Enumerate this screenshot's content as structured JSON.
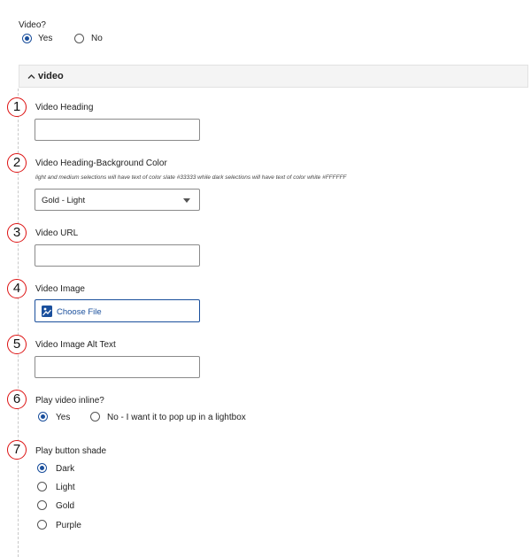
{
  "video_toggle": {
    "label": "Video?",
    "options": [
      "Yes",
      "No"
    ],
    "selected": "Yes"
  },
  "section": {
    "chevron": "chevron-up-icon",
    "title": "video"
  },
  "fields": {
    "heading": {
      "number": "1",
      "label": "Video Heading",
      "value": ""
    },
    "bg_color": {
      "number": "2",
      "label": "Video Heading-Background Color",
      "help": "light and medium selections will have text of color slate #33333 while dark selections will have text of color white #FFFFFF",
      "value": "Gold - Light"
    },
    "url": {
      "number": "3",
      "label": "Video URL",
      "value": ""
    },
    "image": {
      "number": "4",
      "label": "Video Image",
      "button": "Choose File",
      "icon": "image-file-icon"
    },
    "alt_text": {
      "number": "5",
      "label": "Video Image Alt Text",
      "value": ""
    },
    "inline": {
      "number": "6",
      "label": "Play video inline?",
      "options": [
        "Yes",
        "No - I want it to pop up in a lightbox"
      ],
      "selected": "Yes"
    },
    "shade": {
      "number": "7",
      "label": "Play button shade",
      "options": [
        "Dark",
        "Light",
        "Gold",
        "Purple"
      ],
      "selected": "Dark"
    }
  },
  "colors": {
    "accent": "#1a4f9c",
    "annotation": "#dd1111"
  }
}
